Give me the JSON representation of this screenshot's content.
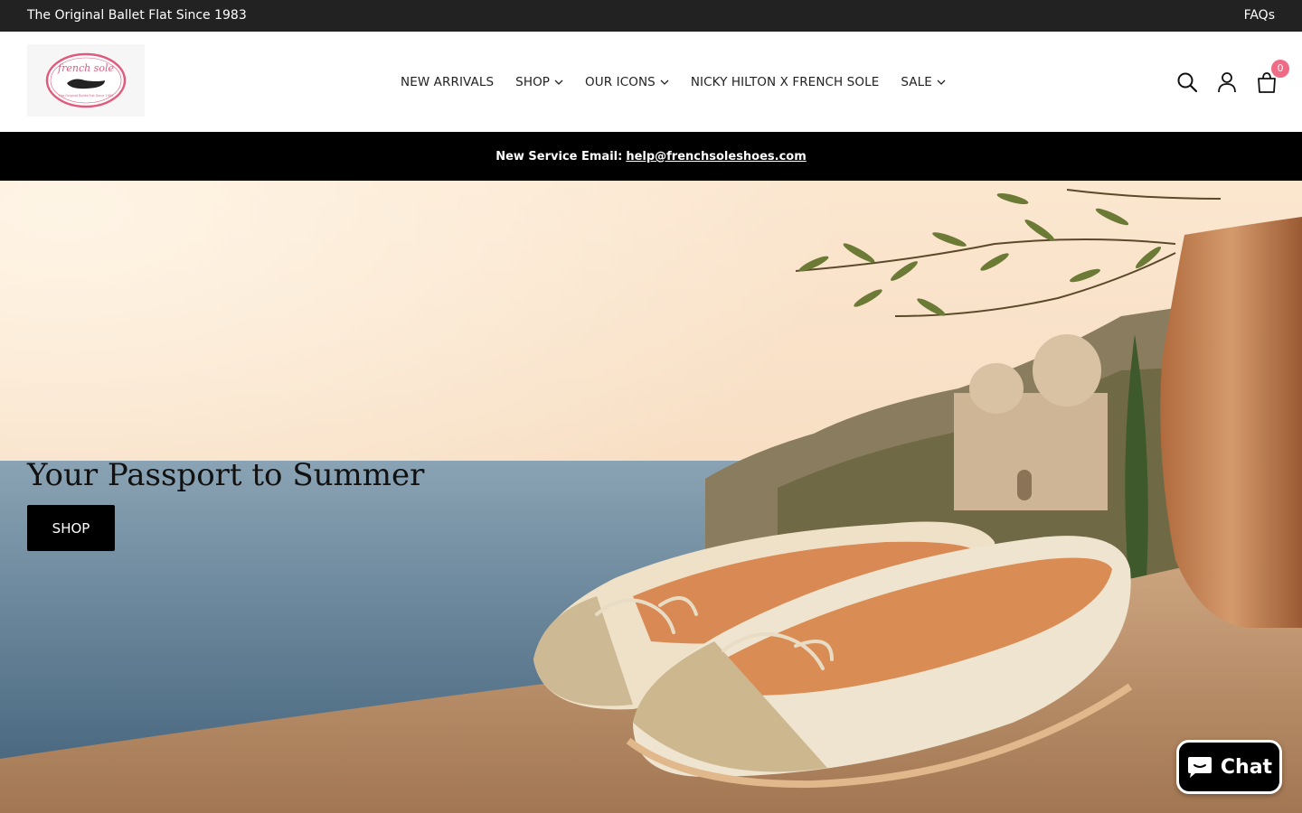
{
  "topbar": {
    "tagline": "The Original Ballet Flat Since 1983",
    "faqs_label": "FAQs"
  },
  "header": {
    "logo_text": "french sole",
    "logo_subtext": "The Original Ballet Flat Since 1983",
    "nav": [
      {
        "label": "NEW ARRIVALS",
        "has_dropdown": false
      },
      {
        "label": "SHOP",
        "has_dropdown": true
      },
      {
        "label": "OUR ICONS",
        "has_dropdown": true
      },
      {
        "label": "NICKY HILTON X FRENCH SOLE",
        "has_dropdown": false
      },
      {
        "label": "SALE",
        "has_dropdown": true
      }
    ],
    "icons": [
      "search-icon",
      "account-icon",
      "cart-icon"
    ],
    "cart_count": "0"
  },
  "service": {
    "label": "New Service Email:",
    "email": "help@frenchsoleshoes.com"
  },
  "hero": {
    "title": "Your Passport to Summer",
    "button_label": "SHOP"
  },
  "chat": {
    "label": "Chat"
  },
  "colors": {
    "topbar_bg": "#222222",
    "service_bg": "#000000",
    "badge": "#ef6b86",
    "logo_pink": "#e05a7d"
  }
}
